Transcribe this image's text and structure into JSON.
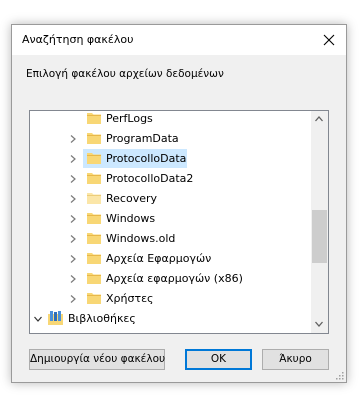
{
  "dialog": {
    "title": "Αναζήτηση φακέλου",
    "instruction": "Επιλογή φακέλου αρχείων δεδομένων",
    "close_icon": "close-icon"
  },
  "tree": {
    "items": [
      {
        "label": "PerfLogs",
        "has_children": false,
        "icon": "folder-icon",
        "selected": false
      },
      {
        "label": "ProgramData",
        "has_children": true,
        "icon": "folder-icon",
        "selected": false
      },
      {
        "label": "ProtocolloData",
        "has_children": true,
        "icon": "folder-icon",
        "selected": true
      },
      {
        "label": "ProtocolloData2",
        "has_children": true,
        "icon": "folder-icon",
        "selected": false
      },
      {
        "label": "Recovery",
        "has_children": true,
        "icon": "folder-icon",
        "selected": false
      },
      {
        "label": "Windows",
        "has_children": true,
        "icon": "folder-icon",
        "selected": false
      },
      {
        "label": "Windows.old",
        "has_children": true,
        "icon": "folder-icon",
        "selected": false
      },
      {
        "label": "Αρχεία Εφαρμογών",
        "has_children": true,
        "icon": "folder-icon",
        "selected": false
      },
      {
        "label": "Αρχεία εφαρμογών (x86)",
        "has_children": true,
        "icon": "folder-icon",
        "selected": false
      },
      {
        "label": "Χρήστες",
        "has_children": true,
        "icon": "folder-icon",
        "selected": false
      },
      {
        "label": "Βιβλιοθήκες",
        "has_children": true,
        "expanded": true,
        "icon": "libraries-icon",
        "selected": false
      }
    ]
  },
  "buttons": {
    "new_folder": "Δημιουργία νέου φακέλου",
    "ok": "OK",
    "cancel": "Άκυρο"
  },
  "colors": {
    "selection": "#cce8ff",
    "folder": "#f8d775",
    "accent": "#0078d7"
  }
}
